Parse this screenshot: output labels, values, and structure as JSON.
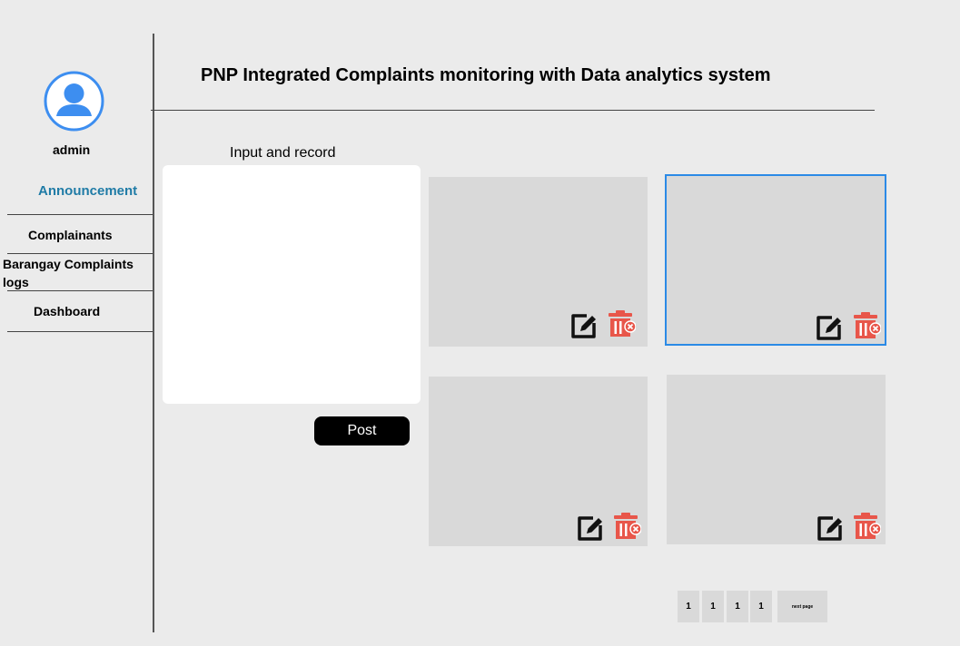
{
  "sidebar": {
    "username": "admin",
    "items": [
      {
        "label": "Announcement",
        "active": true
      },
      {
        "label": "Complainants"
      },
      {
        "label": "Barangay Complaints logs"
      },
      {
        "label": "Dashboard"
      }
    ]
  },
  "header": {
    "title": "PNP Integrated Complaints monitoring with Data analytics system"
  },
  "composer": {
    "label": "Input and record",
    "value": "",
    "post_label": "Post"
  },
  "cards": [
    {
      "selected": false,
      "edit_icon": "edit-icon",
      "delete_icon": "trash-icon"
    },
    {
      "selected": true,
      "edit_icon": "edit-icon",
      "delete_icon": "trash-icon"
    },
    {
      "selected": false,
      "edit_icon": "edit-icon",
      "delete_icon": "trash-icon"
    },
    {
      "selected": false,
      "edit_icon": "edit-icon",
      "delete_icon": "trash-icon"
    }
  ],
  "pagination": {
    "pages": [
      "1",
      "1",
      "1",
      "1"
    ],
    "next_label": "next page"
  },
  "colors": {
    "background": "#ebebeb",
    "accent": "#1f7ba6",
    "avatar": "#3d8ef0",
    "selected_border": "#2b8ae6",
    "delete": "#e8564a"
  }
}
